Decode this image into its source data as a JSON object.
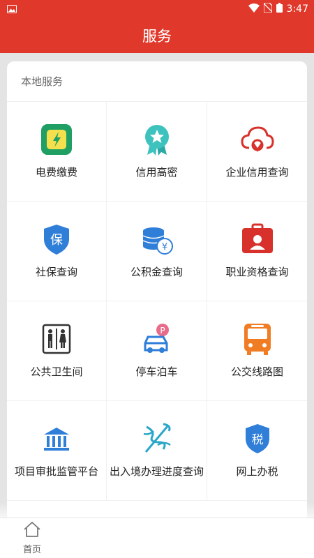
{
  "statusbar": {
    "time": "3:47",
    "left_icon": "image-notification-icon",
    "icons": [
      "wifi-icon",
      "no-sim-icon",
      "battery-icon"
    ]
  },
  "header": {
    "title": "服务"
  },
  "section": {
    "title": "本地服务"
  },
  "services": [
    {
      "label": "电费缴费",
      "icon": "electricity-bill-icon",
      "color": "#1f9f63"
    },
    {
      "label": "信用高密",
      "icon": "credit-badge-icon",
      "color": "#3ec2be"
    },
    {
      "label": "企业信用查询",
      "icon": "cloud-search-icon",
      "color": "#d8312b"
    },
    {
      "label": "社保查询",
      "icon": "social-security-shield-icon",
      "color": "#2f7ed8"
    },
    {
      "label": "公积金查询",
      "icon": "fund-coins-icon",
      "color": "#2f7ed8"
    },
    {
      "label": "职业资格查询",
      "icon": "id-badge-icon",
      "color": "#d8312b"
    },
    {
      "label": "公共卫生间",
      "icon": "restroom-icon",
      "color": "#333333"
    },
    {
      "label": "停车泊车",
      "icon": "parking-car-icon",
      "color": "#2f7ed8"
    },
    {
      "label": "公交线路图",
      "icon": "bus-icon",
      "color": "#f07d23"
    },
    {
      "label": "项目审批监管平台",
      "icon": "government-building-icon",
      "color": "#2f7ed8"
    },
    {
      "label": "出入境办理进度查询",
      "icon": "caduceus-icon",
      "color": "#2aa6c9"
    },
    {
      "label": "网上办税",
      "icon": "tax-shield-icon",
      "color": "#2f7ed8"
    }
  ],
  "tabbar": {
    "items": [
      {
        "label": "首页",
        "icon": "home-icon"
      }
    ]
  },
  "colors": {
    "brand": "#e0392c"
  }
}
